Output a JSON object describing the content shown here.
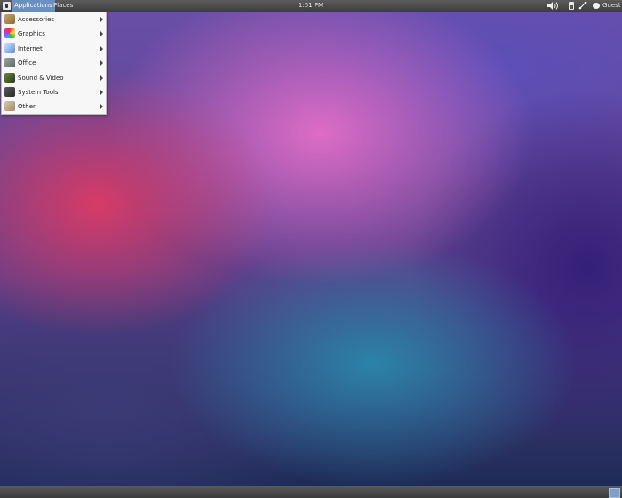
{
  "top_panel": {
    "applications_label": "Applications",
    "places_label": "Places",
    "clock": "1:51 PM",
    "user_label": "Guest",
    "icons": [
      "distro-logo-icon",
      "volume-icon",
      "battery-icon",
      "network-icon",
      "user-status-icon"
    ]
  },
  "apps_menu": {
    "items": [
      {
        "label": "Accessories",
        "icon": "accessories-icon",
        "has_submenu": true
      },
      {
        "label": "Graphics",
        "icon": "graphics-icon",
        "has_submenu": true
      },
      {
        "label": "Internet",
        "icon": "internet-icon",
        "has_submenu": true
      },
      {
        "label": "Office",
        "icon": "office-icon",
        "has_submenu": true
      },
      {
        "label": "Sound & Video",
        "icon": "sound-video-icon",
        "has_submenu": true
      },
      {
        "label": "System Tools",
        "icon": "system-tools-icon",
        "has_submenu": true
      },
      {
        "label": "Other",
        "icon": "other-icon",
        "has_submenu": true
      }
    ]
  },
  "bottom_panel": {
    "icons": [
      "workspace-switcher-icon"
    ]
  },
  "colors": {
    "panel": "#4a4a4a",
    "highlight": "#6b8fbf",
    "menu_bg": "#f7f7f7"
  }
}
